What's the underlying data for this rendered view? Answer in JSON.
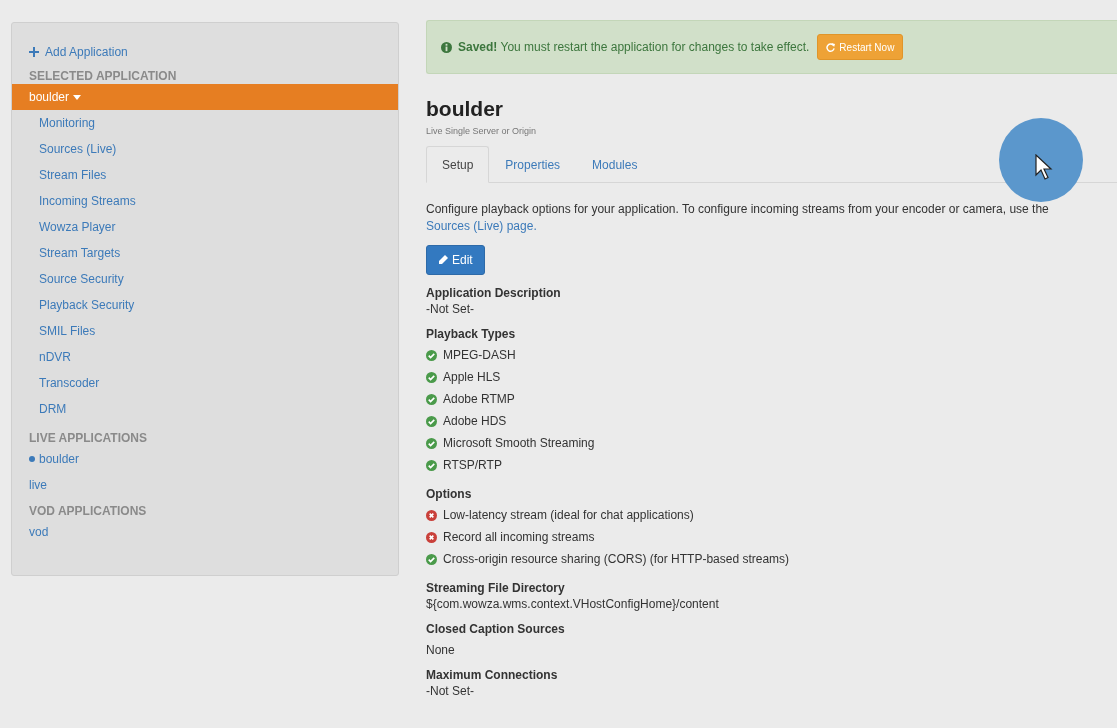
{
  "sidebar": {
    "add_link": "Add Application",
    "selected_header": "SELECTED APPLICATION",
    "selected_app": {
      "name": "boulder",
      "expanded": true
    },
    "app_menu": [
      "Monitoring",
      "Sources (Live)",
      "Stream Files",
      "Incoming Streams",
      "Wowza Player",
      "Stream Targets",
      "Source Security",
      "Playback Security",
      "SMIL Files",
      "nDVR",
      "Transcoder",
      "DRM"
    ],
    "live_header": "LIVE APPLICATIONS",
    "live_apps": [
      {
        "name": "boulder",
        "running": true
      },
      {
        "name": "live",
        "running": false
      }
    ],
    "vod_header": "VOD APPLICATIONS",
    "vod_apps": [
      {
        "name": "vod",
        "running": false
      }
    ]
  },
  "alert": {
    "strong": "Saved!",
    "message": "You must restart the application for changes to take effect.",
    "button": "Restart Now"
  },
  "app": {
    "title": "boulder",
    "subtitle": "Live Single Server or Origin"
  },
  "tabs": [
    {
      "label": "Setup",
      "selected": true
    },
    {
      "label": "Properties",
      "selected": false
    },
    {
      "label": "Modules",
      "selected": false
    }
  ],
  "intro": "Configure playback options for your application. To configure incoming streams from your encoder or camera, use the ",
  "intro_link": "Sources (Live) page.",
  "edit_button": "Edit",
  "sections": [
    {
      "kind": "text",
      "title": "Application Description",
      "value": "-Not Set-"
    },
    {
      "kind": "list",
      "title": "Playback Types",
      "items": [
        {
          "label": "MPEG-DASH",
          "enabled": true
        },
        {
          "label": "Apple HLS",
          "enabled": true
        },
        {
          "label": "Adobe RTMP",
          "enabled": true
        },
        {
          "label": "Adobe HDS",
          "enabled": true
        },
        {
          "label": "Microsoft Smooth Streaming",
          "enabled": true
        },
        {
          "label": "RTSP/RTP",
          "enabled": true
        }
      ]
    },
    {
      "kind": "list",
      "title": "Options",
      "items": [
        {
          "label": "Low-latency stream (ideal for chat applications)",
          "enabled": false
        },
        {
          "label": "Record all incoming streams",
          "enabled": false
        },
        {
          "label": "Cross-origin resource sharing (CORS) (for HTTP-based streams)",
          "enabled": true
        }
      ]
    },
    {
      "kind": "text",
      "title": "Streaming File Directory",
      "value": "${com.wowza.wms.context.VHostConfigHome}/content"
    },
    {
      "kind": "text",
      "title": "Closed Caption Sources",
      "value": "None",
      "spaced": true
    },
    {
      "kind": "text",
      "title": "Maximum Connections",
      "value": "-Not Set-"
    }
  ]
}
